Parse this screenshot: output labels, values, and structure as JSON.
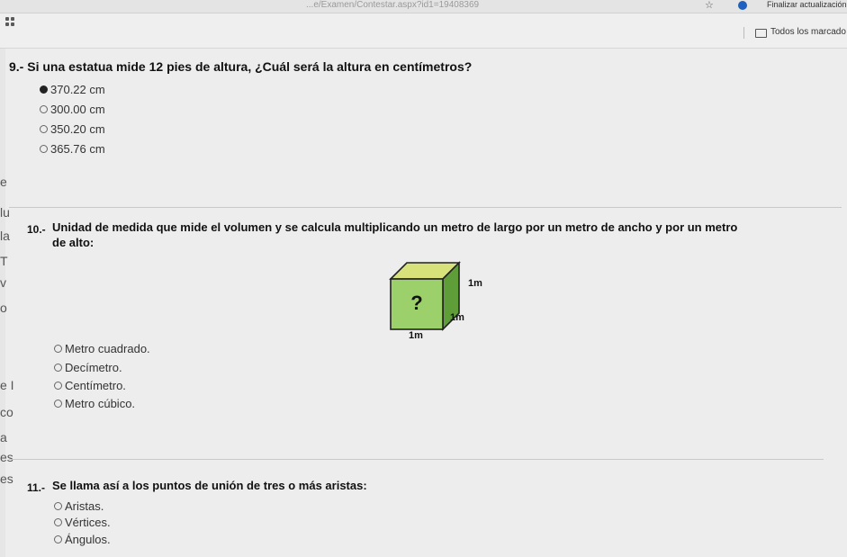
{
  "browser": {
    "url": "...e/Examen/Contestar.aspx?id1=19408369",
    "update_label": "Finalizar actualización",
    "bookmarks_all": "Todos los marcado"
  },
  "peek_letters": [
    "e",
    "lu",
    "la",
    "T",
    "v",
    "o",
    "e I",
    "co",
    "a",
    "es",
    "es"
  ],
  "q9": {
    "number": "9.-",
    "text": "Si una estatua mide 12 pies de altura, ¿Cuál será la altura en centímetros?",
    "options": [
      {
        "label": "370.22 cm",
        "checked": true
      },
      {
        "label": "300.00 cm",
        "checked": false
      },
      {
        "label": "350.20 cm",
        "checked": false
      },
      {
        "label": "365.76 cm",
        "checked": false
      }
    ]
  },
  "q10": {
    "number": "10.-",
    "text_line1": "Unidad de medida que mide el volumen y se calcula multiplicando un metro de largo por un metro de ancho y por un metro",
    "text_line2": "de alto:",
    "figure": {
      "question_mark": "?",
      "label_top": "1m",
      "label_side": "1m",
      "label_bottom": "1m"
    },
    "options": [
      {
        "label": "Metro cuadrado.",
        "checked": false
      },
      {
        "label": "Decímetro.",
        "checked": false
      },
      {
        "label": "Centímetro.",
        "checked": false
      },
      {
        "label": "Metro cúbico.",
        "checked": false
      }
    ]
  },
  "q11": {
    "number": "11.-",
    "text": "Se llama así a los puntos de unión de tres o más aristas:",
    "options": [
      {
        "label": "Aristas.",
        "checked": false
      },
      {
        "label": "Vértices.",
        "checked": false
      },
      {
        "label": "Ángulos.",
        "checked": false
      }
    ]
  }
}
